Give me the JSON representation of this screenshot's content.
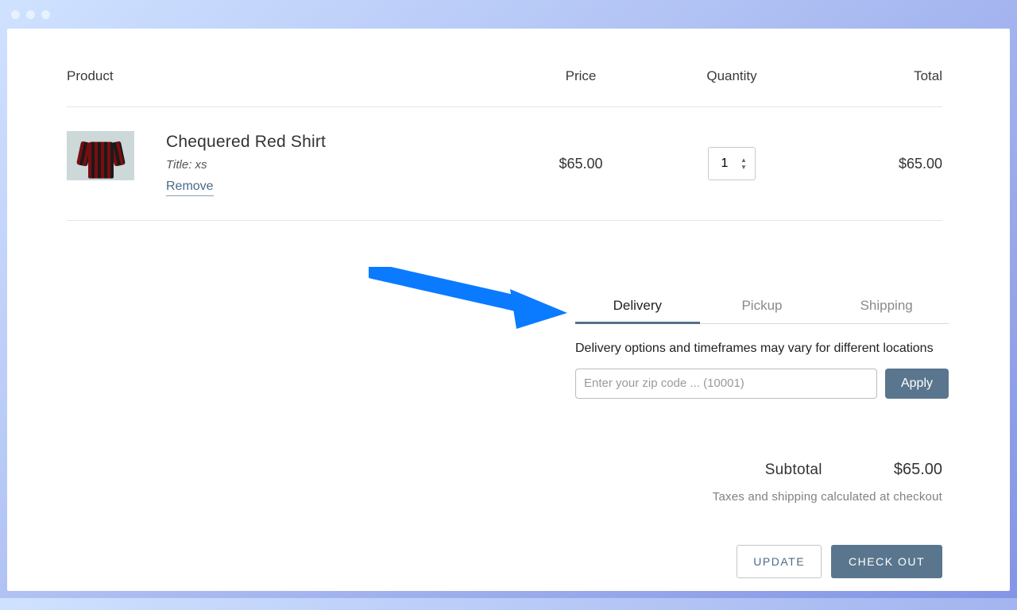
{
  "columns": {
    "product": "Product",
    "price": "Price",
    "quantity": "Quantity",
    "total": "Total"
  },
  "item": {
    "title": "Chequered Red Shirt",
    "variant": "Title: xs",
    "remove": "Remove",
    "price": "$65.00",
    "quantity": "1",
    "line_total": "$65.00"
  },
  "tabs": {
    "delivery": "Delivery",
    "pickup": "Pickup",
    "shipping": "Shipping"
  },
  "delivery": {
    "note": "Delivery options and timeframes may vary for different locations",
    "zip_placeholder": "Enter your zip code ... (10001)",
    "apply": "Apply"
  },
  "totals": {
    "subtotal_label": "Subtotal",
    "subtotal_value": "$65.00",
    "tax_note": "Taxes and shipping calculated at checkout"
  },
  "actions": {
    "update": "UPDATE",
    "checkout": "CHECK OUT"
  }
}
